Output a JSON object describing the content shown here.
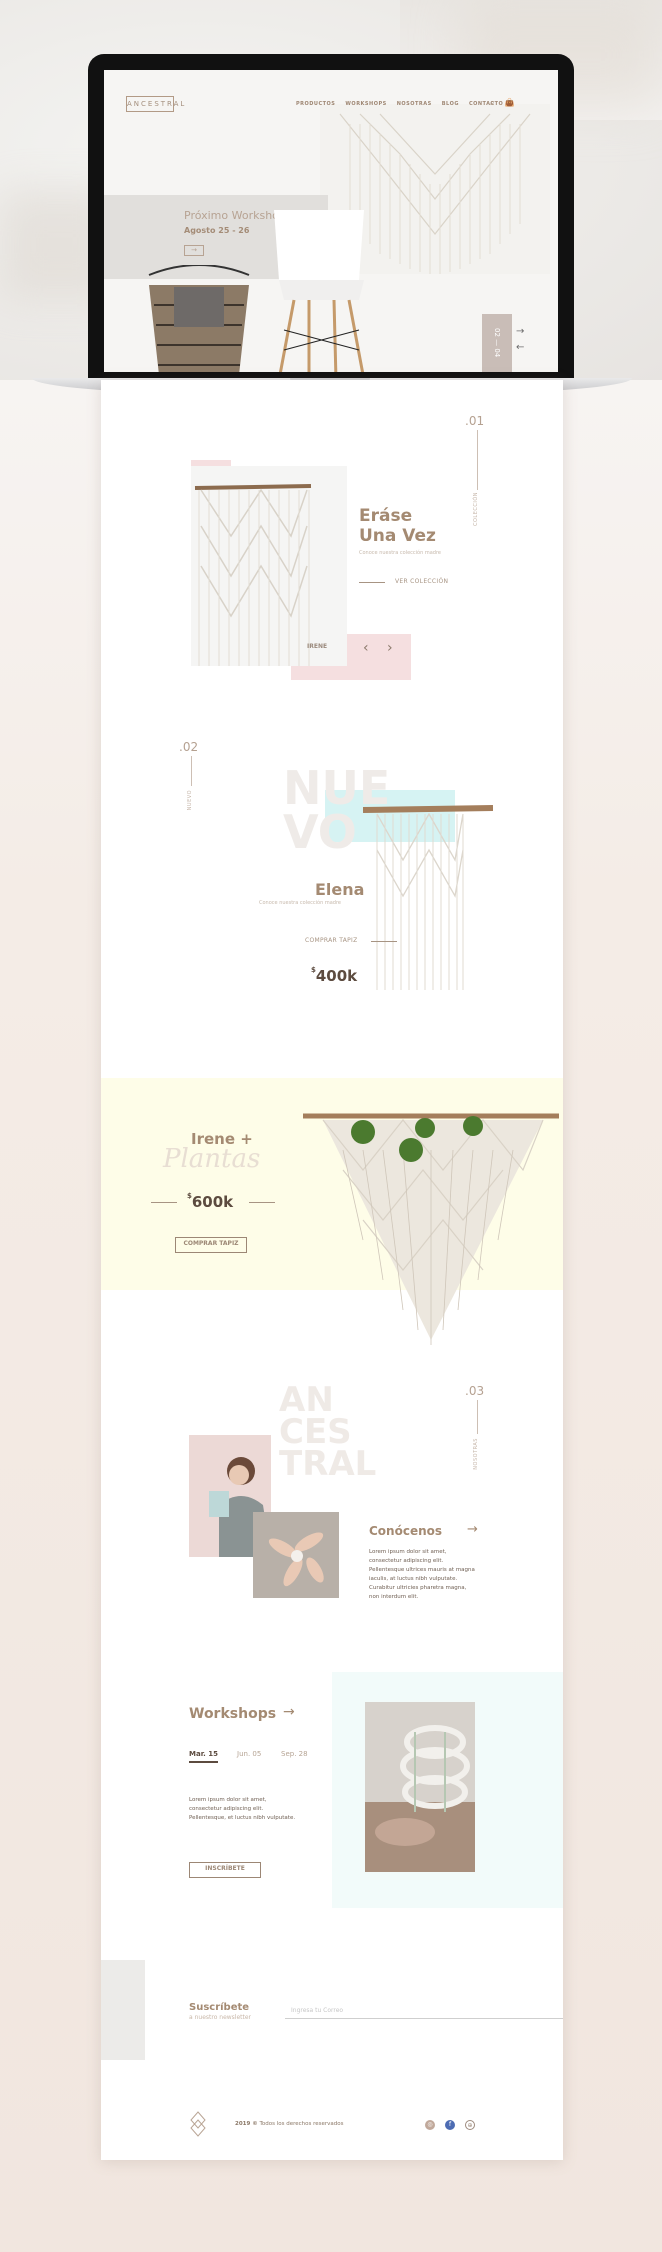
{
  "brand": {
    "logo": "ANCESTRAL"
  },
  "nav": {
    "items": [
      "PRODUCTOS",
      "WORKSHOPS",
      "NOSOTRAS",
      "BLOG",
      "CONTACTO"
    ]
  },
  "hero": {
    "title": "Próximo Workshop",
    "date": "Agosto 25 - 26",
    "button": "→",
    "slider": "02 — 04",
    "next": "→",
    "prev": "←"
  },
  "section1": {
    "num": ".01",
    "vlabel": "COLECCIÓN",
    "title1": "Eráse",
    "title2": "Una Vez",
    "sub": "Conoce nuestra colección madre",
    "link": "VER COLECCIÓN",
    "tag": "IRENE",
    "prev": "‹",
    "next": "›"
  },
  "section2": {
    "num": ".02",
    "vlabel": "NUEVO",
    "bigtext1": "NUE",
    "bigtext2": "VO",
    "title": "Elena",
    "sub": "Conoce nuestra colección madre",
    "link": "COMPRAR TAPIZ",
    "price_symbol": "$",
    "price": "400k"
  },
  "section3": {
    "title1": "Irene +",
    "title2": "Plantas",
    "price_symbol": "$",
    "price": "600k",
    "button": "COMPRAR TAPIZ"
  },
  "section4": {
    "num": ".03",
    "vlabel": "NOSOTRAS",
    "big1": "AN",
    "big2": "CES",
    "big3": "TRAL",
    "title": "Conócenos",
    "arrow": "→",
    "body": "Lorem ipsum dolor sit amet, consectetur adipiscing elit. Pellentesque ultrices mauris at magna iaculis, at luctus nibh vulputate. Curabitur ultricies pharetra magna, non interdum elit."
  },
  "workshops": {
    "title": "Workshops",
    "arrow": "→",
    "tabs": [
      "Mar. 15",
      "Jun. 05",
      "Sep. 28"
    ],
    "body": "Lorem ipsum dolor sit amet, consectetur adipiscing elit. Pellentesque, et luctus nibh vulputate.",
    "button": "INSCRÍBETE"
  },
  "newsletter": {
    "title": "Suscríbete",
    "sub": "a nuestro newsletter",
    "placeholder": "Ingresa tu Correo"
  },
  "footer": {
    "year": "2019 ©",
    "rights": "Todos los derechos reservados"
  },
  "colors": {
    "accent": "#a48a72",
    "pink": "#f5dfe0",
    "yellow": "#fefde8",
    "mint": "#f2fbfa"
  }
}
